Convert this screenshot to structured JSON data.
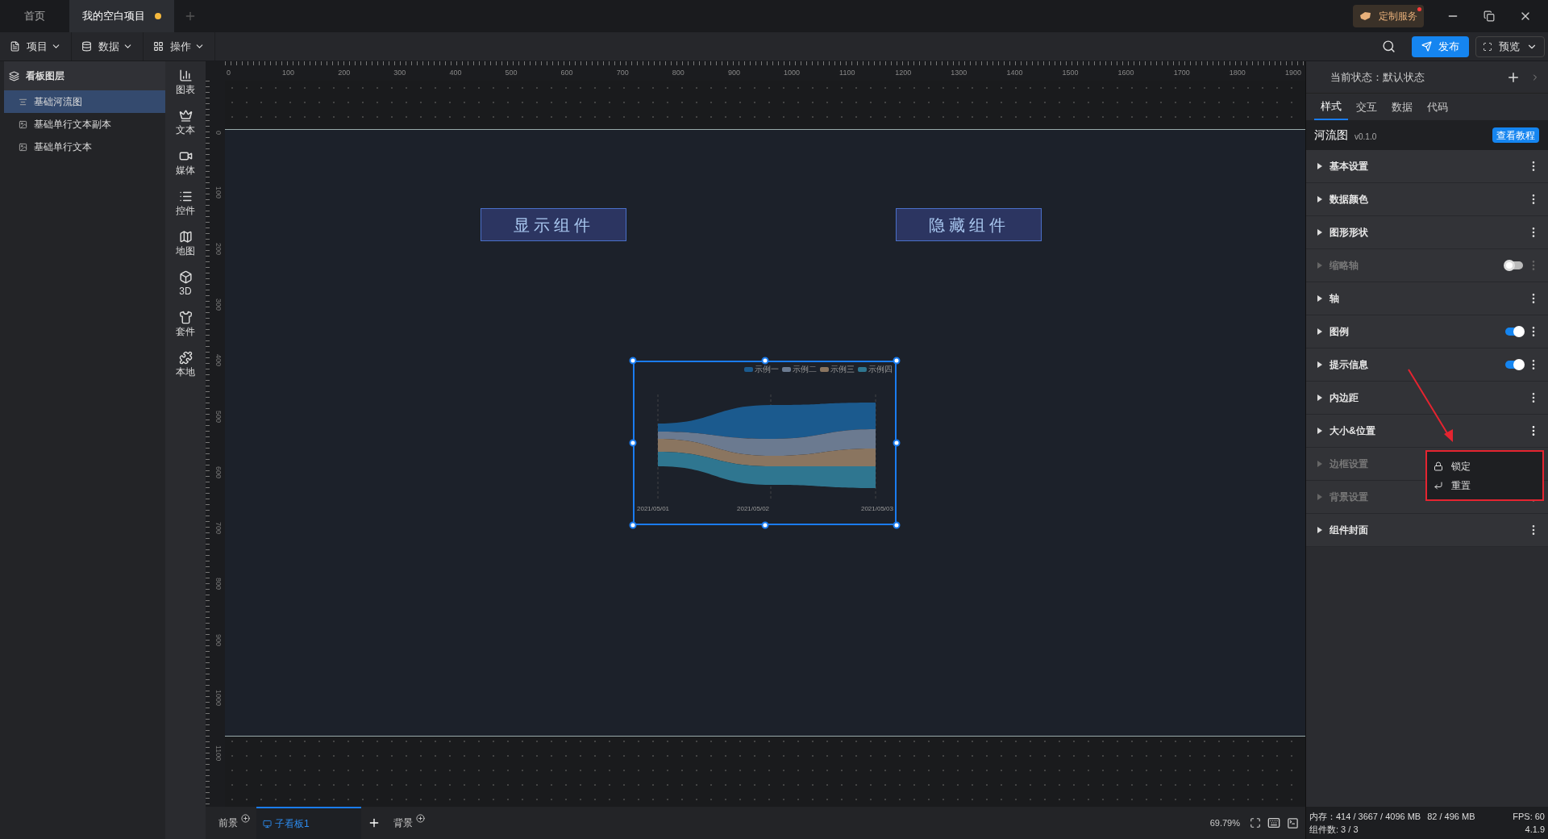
{
  "tabs": [
    {
      "label": "首页",
      "selected": false,
      "modified": false
    },
    {
      "label": "我的空白项目",
      "selected": true,
      "modified": true
    }
  ],
  "top_right": {
    "service": "定制服务",
    "notification": true
  },
  "toolbar": {
    "menus": [
      {
        "label": "项目",
        "kind": "file"
      },
      {
        "label": "数据",
        "kind": "database"
      },
      {
        "label": "操作",
        "kind": "grid"
      }
    ],
    "publish": "发布",
    "preview": "预览"
  },
  "layers": {
    "title": "看板图层",
    "items": [
      {
        "label": "基础河流图",
        "kind": "chart",
        "selected": true
      },
      {
        "label": "基础单行文本副本",
        "kind": "text",
        "selected": false
      },
      {
        "label": "基础单行文本",
        "kind": "text",
        "selected": false
      }
    ]
  },
  "palette": [
    {
      "label": "图表",
      "kind": "chart"
    },
    {
      "label": "文本",
      "kind": "text"
    },
    {
      "label": "媒体",
      "kind": "media"
    },
    {
      "label": "控件",
      "kind": "control"
    },
    {
      "label": "地图",
      "kind": "map"
    },
    {
      "label": "3D",
      "kind": "cube"
    },
    {
      "label": "套件",
      "kind": "kit"
    },
    {
      "label": "本地",
      "kind": "local"
    }
  ],
  "rulers": {
    "horizontal": [
      "0",
      "100",
      "200",
      "300",
      "400",
      "500",
      "600",
      "700",
      "800",
      "900",
      "1000",
      "1100",
      "1200",
      "1300",
      "1400",
      "1500",
      "1600",
      "1700",
      "1800",
      "1900"
    ],
    "vertical": [
      "0",
      "100",
      "200",
      "300",
      "400",
      "500",
      "600",
      "700",
      "800",
      "900",
      "1000",
      "1100"
    ]
  },
  "canvas": {
    "buttons": [
      "显示组件",
      "隐藏组件"
    ],
    "chart": {
      "selected": true,
      "legend": [
        {
          "label": "示例一",
          "color": "#1b5a8e"
        },
        {
          "label": "示例二",
          "color": "#6b7a90"
        },
        {
          "label": "示例三",
          "color": "#8a7560"
        },
        {
          "label": "示例四",
          "color": "#2f7690"
        }
      ],
      "x_labels": [
        "2021/05/01",
        "2021/05/02",
        "2021/05/03"
      ]
    }
  },
  "inspector": {
    "state_label": "当前状态：默认状态",
    "tabs": [
      {
        "label": "样式",
        "selected": true
      },
      {
        "label": "交互",
        "selected": false
      },
      {
        "label": "数据",
        "selected": false
      },
      {
        "label": "代码",
        "selected": false
      }
    ],
    "component": "河流图",
    "version": "v0.1.0",
    "tutorial": "查看教程",
    "sections": [
      {
        "label": "基本设置",
        "disabled": false
      },
      {
        "label": "数据颜色",
        "disabled": false
      },
      {
        "label": "图形形状",
        "disabled": false
      },
      {
        "label": "缩略轴",
        "disabled": true,
        "toggle": false
      },
      {
        "label": "轴",
        "disabled": false
      },
      {
        "label": "图例",
        "disabled": false,
        "toggle": true
      },
      {
        "label": "提示信息",
        "disabled": false,
        "toggle": true
      },
      {
        "label": "内边距",
        "disabled": false
      },
      {
        "label": "大小&位置",
        "disabled": false,
        "menu_open": true
      },
      {
        "label": "边框设置",
        "disabled": true
      },
      {
        "label": "背景设置",
        "disabled": true
      },
      {
        "label": "组件封面",
        "disabled": false
      }
    ]
  },
  "context_menu": {
    "items": [
      {
        "label": "锁定",
        "kind": "lock"
      },
      {
        "label": "重置",
        "kind": "reset"
      }
    ]
  },
  "bottom": {
    "tabs": [
      {
        "label": "前景",
        "kind": "layer",
        "selected": false
      },
      {
        "label": "子看板1",
        "kind": "board",
        "selected": true
      },
      {
        "label": "背景",
        "kind": "layer",
        "selected": false
      }
    ],
    "zoom": "69.79%",
    "memory": "内存：414 / 3667 / 4096 MB",
    "gpu": "82 / 496 MB",
    "fps": "FPS: 60",
    "component_count": "组件数: 3 / 3",
    "version": "4.1.9"
  }
}
